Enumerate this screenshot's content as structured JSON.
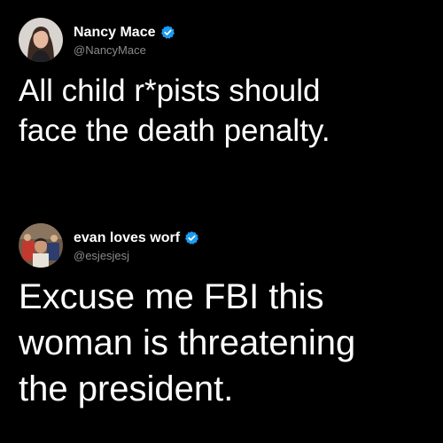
{
  "tweets": [
    {
      "display_name": "Nancy Mace",
      "handle": "@NancyMace",
      "verified": true,
      "text": "All child r*pists should\nface the death penalty."
    },
    {
      "display_name": "evan loves worf",
      "handle": "@esjesjesj",
      "verified": true,
      "text": "Excuse me FBI this\nwoman is threatening\nthe president."
    }
  ],
  "colors": {
    "background": "#000000",
    "text": "#ffffff",
    "handle": "#8b8b8b",
    "verified_badge": "#1d9bf0"
  },
  "icons": {
    "verified": "verified-badge-icon"
  }
}
